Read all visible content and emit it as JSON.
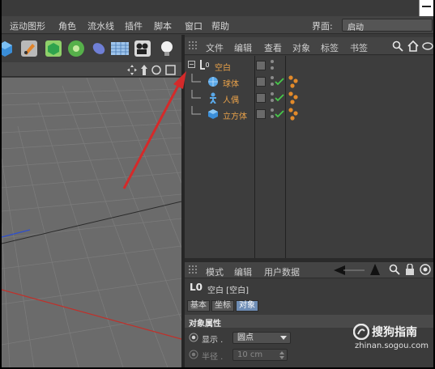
{
  "menubar": {
    "items": [
      "运动图形",
      "角色",
      "流水线",
      "插件",
      "脚本",
      "窗口",
      "帮助"
    ],
    "layout_label": "界面:",
    "layout_value": "启动"
  },
  "object_manager": {
    "menu": [
      "文件",
      "编辑",
      "查看",
      "对象",
      "标签",
      "书签"
    ],
    "objects": [
      {
        "name": "空白",
        "icon": "null-object-icon",
        "level": 0,
        "color": "#e8a14a"
      },
      {
        "name": "球体",
        "icon": "sphere-icon",
        "level": 1,
        "color": "#e8a14a"
      },
      {
        "name": "人偶",
        "icon": "figure-icon",
        "level": 1,
        "color": "#e8a14a"
      },
      {
        "name": "立方体",
        "icon": "cube-icon",
        "level": 1,
        "color": "#e8a14a"
      }
    ]
  },
  "attribute_manager": {
    "menu": [
      "模式",
      "编辑",
      "用户数据"
    ],
    "title_glyph": "L0",
    "title": "空白 [空白]",
    "tabs": [
      "基本",
      "坐标",
      "对象"
    ],
    "active_tab": "对象",
    "section": "对象属性",
    "display_label": "显示 .",
    "display_value": "圆点",
    "radius_label": "半径 .",
    "radius_value": "10 cm"
  },
  "watermark": {
    "brand": "搜狗指南",
    "url": "zhinan.sogou.com"
  },
  "colors": {
    "accent_orange": "#e8a14a",
    "arrow_red": "#d42a2a",
    "check_green": "#47c84a",
    "active_tab": "#6e8db5"
  }
}
